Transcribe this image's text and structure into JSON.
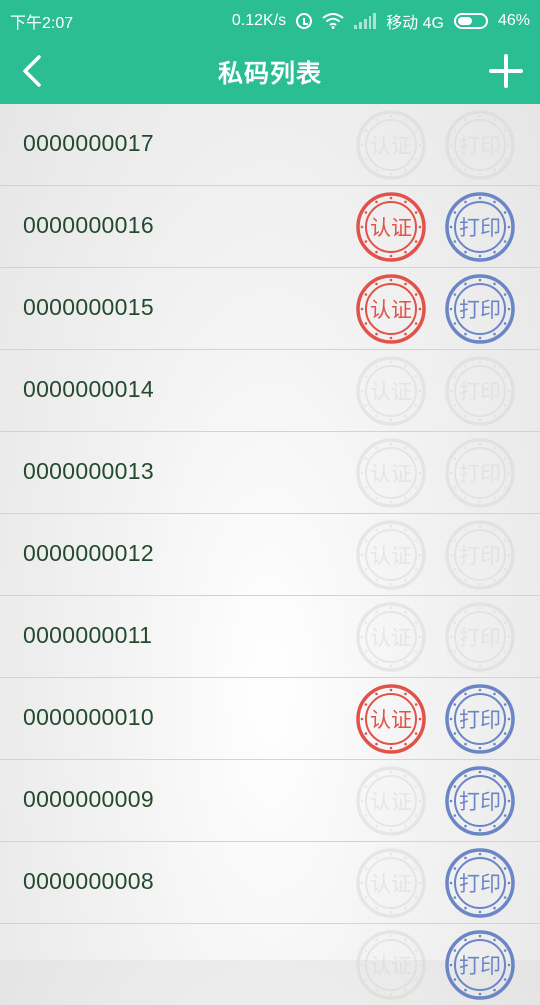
{
  "status_bar": {
    "time": "下午2:07",
    "net_speed": "0.12K/s",
    "carrier": "移动 4G",
    "battery": "46%"
  },
  "app_bar": {
    "title": "私码列表",
    "back_icon": "chevron-left-icon",
    "add_icon": "plus-icon"
  },
  "colors": {
    "header": "#2bbd94",
    "auth_active": "#e0524a",
    "print_active": "#6b86c6",
    "inactive": "#cfd9cf",
    "code_text": "#244a2e"
  },
  "seal_labels": {
    "auth": "认证",
    "print": "打印"
  },
  "rows": [
    {
      "code": "0000000017",
      "auth": false,
      "print": false
    },
    {
      "code": "0000000016",
      "auth": true,
      "print": true
    },
    {
      "code": "0000000015",
      "auth": true,
      "print": true
    },
    {
      "code": "0000000014",
      "auth": false,
      "print": false
    },
    {
      "code": "0000000013",
      "auth": false,
      "print": false
    },
    {
      "code": "0000000012",
      "auth": false,
      "print": false
    },
    {
      "code": "0000000011",
      "auth": false,
      "print": false
    },
    {
      "code": "0000000010",
      "auth": true,
      "print": true
    },
    {
      "code": "0000000009",
      "auth": false,
      "print": true
    },
    {
      "code": "0000000008",
      "auth": false,
      "print": true
    },
    {
      "code": "",
      "auth": false,
      "print": true
    }
  ]
}
